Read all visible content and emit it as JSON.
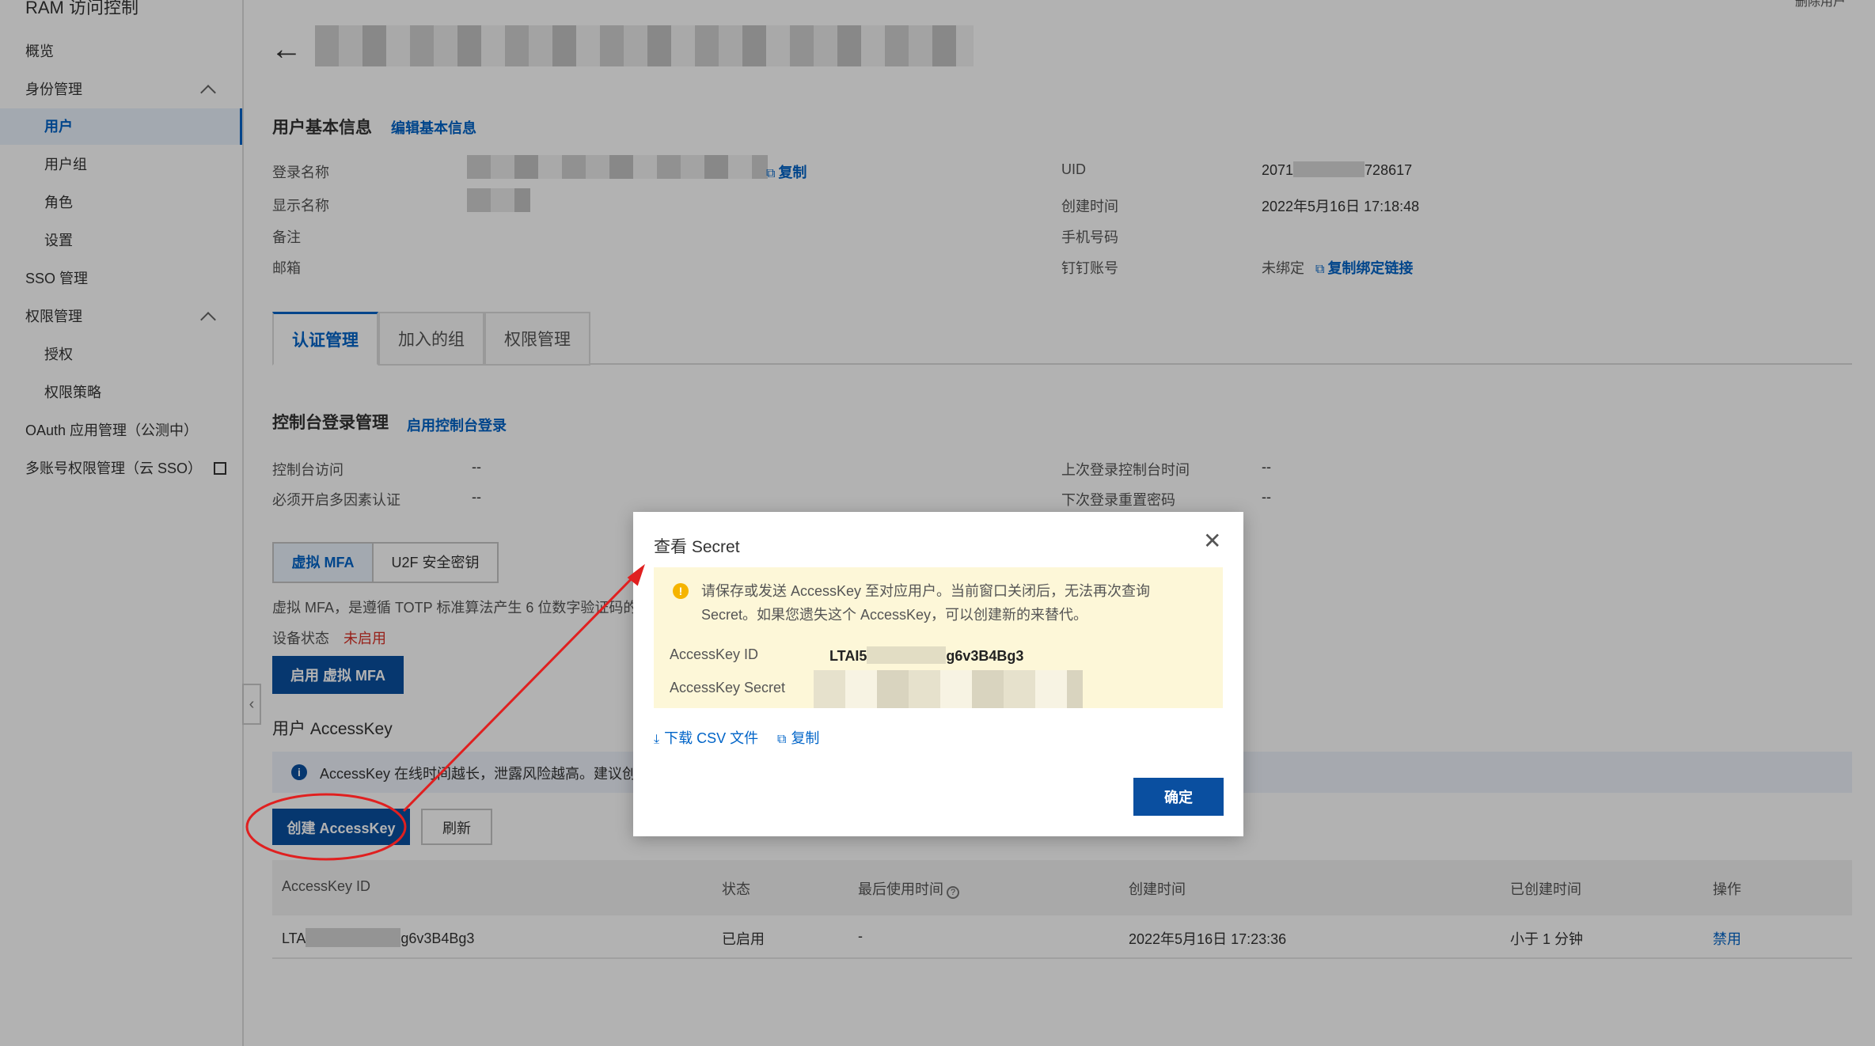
{
  "app": {
    "title": "RAM 访问控制",
    "top_right": "删除用户"
  },
  "sidebar": {
    "items": [
      {
        "label": "概览"
      },
      {
        "label": "身份管理"
      },
      {
        "label": "用户"
      },
      {
        "label": "用户组"
      },
      {
        "label": "角色"
      },
      {
        "label": "设置"
      },
      {
        "label": "SSO 管理"
      },
      {
        "label": "权限管理"
      },
      {
        "label": "授权"
      },
      {
        "label": "权限策略"
      },
      {
        "label": "OAuth 应用管理（公测中）"
      },
      {
        "label": "多账号权限管理（云 SSO）"
      }
    ]
  },
  "basic_info": {
    "heading": "用户基本信息",
    "edit_link": "编辑基本信息",
    "login_name_label": "登录名称",
    "copy_link": "复制",
    "display_name_label": "显示名称",
    "note_label": "备注",
    "email_label": "邮箱",
    "uid_label": "UID",
    "uid_prefix": "2071",
    "uid_suffix": "728617",
    "created_label": "创建时间",
    "created_value": "2022年5月16日 17:18:48",
    "phone_label": "手机号码",
    "dingtalk_label": "钉钉账号",
    "dingtalk_value": "未绑定",
    "dingtalk_link": "复制绑定链接"
  },
  "tabs": [
    {
      "label": "认证管理"
    },
    {
      "label": "加入的组"
    },
    {
      "label": "权限管理"
    }
  ],
  "console_login": {
    "heading": "控制台登录管理",
    "enable_link": "启用控制台登录",
    "access_label": "控制台访问",
    "access_value": "--",
    "mfa_label": "必须开启多因素认证",
    "mfa_value": "--",
    "last_login_label": "上次登录控制台时间",
    "last_login_value": "--",
    "reset_label": "下次登录重置密码",
    "reset_value": "--"
  },
  "mfa": {
    "tab_virtual": "虚拟 MFA",
    "tab_u2f": "U2F 安全密钥",
    "desc": "虚拟 MFA，是遵循 TOTP 标准算法产生 6 位数字验证码的",
    "status_label": "设备状态",
    "status_value": "未启用",
    "enable_button": "启用 虚拟 MFA"
  },
  "accesskey": {
    "heading": "用户 AccessKey",
    "notice": "AccessKey 在线时间越长，泄露风险越高。建议创",
    "create_button": "创建 AccessKey",
    "refresh_button": "刷新",
    "columns": [
      "AccessKey ID",
      "状态",
      "最后使用时间",
      "创建时间",
      "已创建时间",
      "操作"
    ],
    "row": {
      "id_prefix": "LTA",
      "id_suffix": "g6v3B4Bg3",
      "status": "已启用",
      "last_used": "-",
      "created": "2022年5月16日 17:23:36",
      "age": "小于 1 分钟",
      "action": "禁用"
    }
  },
  "dialog": {
    "title": "查看 Secret",
    "warning_line1": "请保存或发送 AccessKey 至对应用户。当前窗口关闭后，无法再次查询",
    "warning_line2": "Secret。如果您遗失这个 AccessKey，可以创建新的来替代。",
    "id_label": "AccessKey ID",
    "id_prefix": "LTAI5",
    "id_suffix": "g6v3B4Bg3",
    "secret_label": "AccessKey Secret",
    "download_link": "下载 CSV 文件",
    "copy_link": "复制",
    "ok_button": "确定"
  },
  "colors": {
    "primary": "#0064c8",
    "annotation": "#e02020",
    "warning": "#f5b400"
  }
}
